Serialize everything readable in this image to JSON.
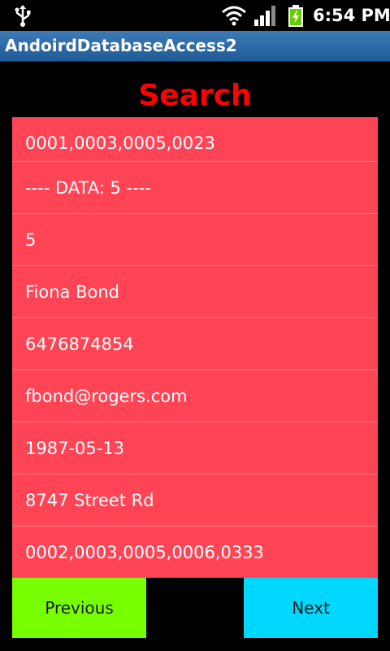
{
  "status_bar": {
    "time": "6:54 PM",
    "icons": [
      "usb-icon",
      "wifi-icon",
      "signal-icon",
      "battery-charging-icon"
    ]
  },
  "app": {
    "title": "AndoirdDatabaseAccess2"
  },
  "search": {
    "heading": "Search",
    "heading_color": "#ff0000"
  },
  "results": {
    "background_color": "#ff4455",
    "items": [
      "0001,0003,0005,0023",
      "---- DATA: 5 ----",
      "5",
      "Fiona Bond",
      "6476874854",
      "fbond@rogers.com",
      "1987-05-13",
      "8747 Street Rd",
      "0002,0003,0005,0006,0333"
    ]
  },
  "buttons": {
    "previous_label": "Previous",
    "previous_color": "#77ff00",
    "next_label": "Next",
    "next_color": "#00d8ff"
  }
}
